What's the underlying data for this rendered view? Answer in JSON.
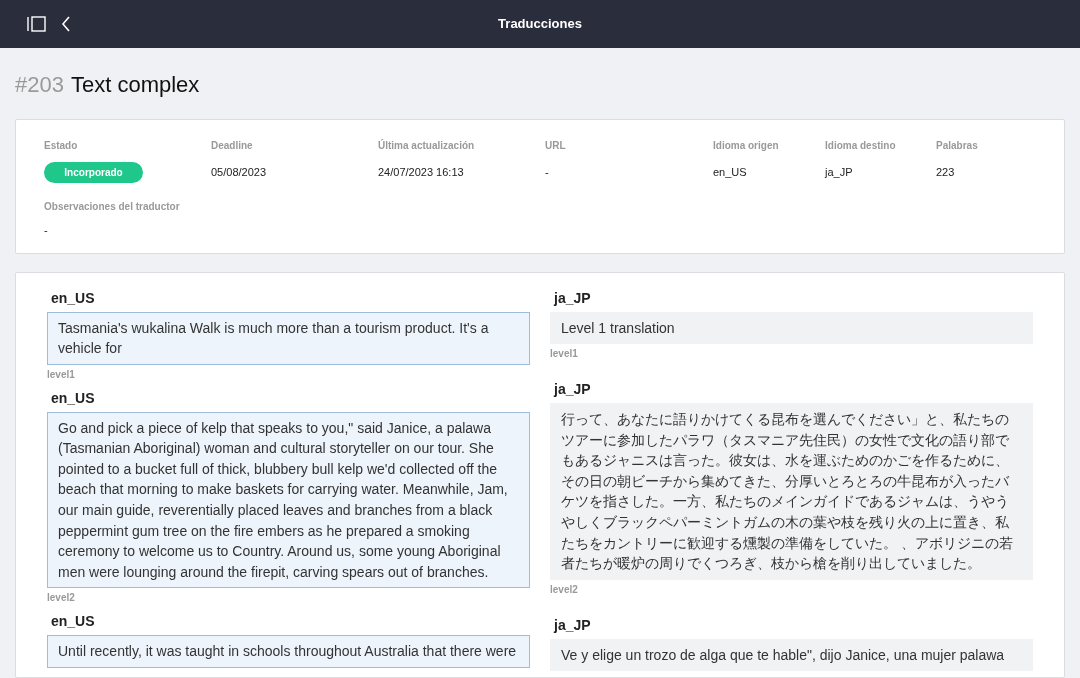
{
  "topbar": {
    "title": "Traducciones"
  },
  "page": {
    "number": "#203",
    "title": "Text complex"
  },
  "info": {
    "fields": [
      {
        "label": "Estado",
        "value": "Incorporado",
        "kind": "badge"
      },
      {
        "label": "Deadline",
        "value": "05/08/2023",
        "kind": "text"
      },
      {
        "label": "Última actualización",
        "value": "24/07/2023 16:13",
        "kind": "text"
      },
      {
        "label": "URL",
        "value": "-",
        "kind": "text"
      },
      {
        "label": "Idioma origen",
        "value": "en_US",
        "kind": "text"
      },
      {
        "label": "Idioma destino",
        "value": "ja_JP",
        "kind": "text"
      },
      {
        "label": "Palabras",
        "value": "223",
        "kind": "text"
      }
    ],
    "observations": {
      "label": "Observaciones del traductor",
      "value": "-"
    }
  },
  "source_segments": [
    {
      "lang": "en_US",
      "text": "Tasmania's wukalina Walk is much more than a tourism product. It's a vehicle for",
      "level_label": "level1"
    },
    {
      "lang": "en_US",
      "text": "Go and pick a piece of kelp that speaks to you,\" said Janice, a palawa (Tasmanian Aboriginal) woman and cultural storyteller on our tour. She pointed to a bucket full of thick, blubbery bull kelp we'd collected off the beach that morning to make baskets for carrying water. Meanwhile, Jam, our main guide, reverentially placed leaves and branches from a black peppermint gum tree on the fire embers as he prepared a smoking ceremony to welcome us to Country. Around us, some young Aboriginal men were lounging around the firepit, carving spears out of branches.",
      "level_label": "level2"
    },
    {
      "lang": "en_US",
      "text": "Until recently, it was taught in schools throughout Australia that there were"
    }
  ],
  "target_segments": [
    {
      "lang": "ja_JP",
      "text": "Level 1 translation",
      "level_label": "level1"
    },
    {
      "lang": "ja_JP",
      "text": "行って、あなたに語りかけてくる昆布を選んでください」と、私たちのツアーに参加したパラワ（タスマニア先住民）の女性で文化の語り部でもあるジャニスは言った。彼女は、水を運ぶためのかごを作るために、その日の朝ビーチから集めてきた、分厚いとろとろの牛昆布が入ったバケツを指さした。一方、私たちのメインガイドであるジャムは、うやうやしくブラックペパーミントガムの木の葉や枝を残り火の上に置き、私たちをカントリーに歓迎する燻製の準備をしていた。 、アボリジニの若者たちが暖炉の周りでくつろぎ、枝から槍を削り出していました。",
      "level_label": "level2"
    },
    {
      "lang": "ja_JP",
      "text": "Ve y elige un trozo de alga que te hable\", dijo Janice, una mujer palawa"
    }
  ]
}
